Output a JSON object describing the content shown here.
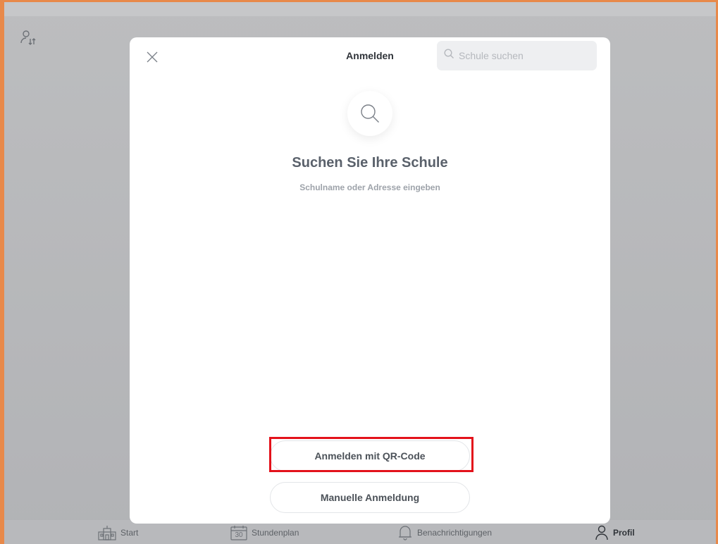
{
  "colors": {
    "accent_border": "#e8894a",
    "highlight": "#e3121b",
    "text_dark": "#30343a",
    "text_muted": "#9ea3aa"
  },
  "modal": {
    "title": "Anmelden",
    "close_icon": "close-icon",
    "search": {
      "placeholder": "Schule suchen",
      "value": "",
      "icon": "search-icon"
    },
    "hero_icon": "magnifier-icon",
    "heading": "Suchen Sie Ihre Schule",
    "subheading": "Schulname oder Adresse eingeben",
    "buttons": {
      "qr_label": "Anmelden mit QR-Code",
      "manual_label": "Manuelle Anmeldung"
    }
  },
  "background": {
    "top_left_icon": "account-switch-icon"
  },
  "tabbar": {
    "items": [
      {
        "label": "Start",
        "icon": "school-icon",
        "active": false
      },
      {
        "label": "Stundenplan",
        "icon": "calendar-icon",
        "day": "30",
        "active": false
      },
      {
        "label": "Benachrichtigungen",
        "icon": "bell-icon",
        "active": false
      },
      {
        "label": "Profil",
        "icon": "person-icon",
        "active": true
      }
    ]
  }
}
